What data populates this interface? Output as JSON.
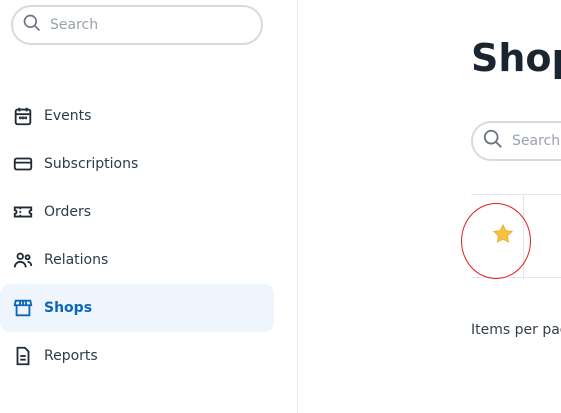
{
  "sidebar": {
    "search_placeholder": "Search",
    "items": [
      {
        "label": "Events",
        "icon": "calendar-icon"
      },
      {
        "label": "Subscriptions",
        "icon": "credit-card-icon"
      },
      {
        "label": "Orders",
        "icon": "ticket-icon"
      },
      {
        "label": "Relations",
        "icon": "people-icon"
      },
      {
        "label": "Shops",
        "icon": "storefront-icon",
        "active": true
      },
      {
        "label": "Reports",
        "icon": "document-icon"
      }
    ]
  },
  "main": {
    "title": "Shop",
    "search_placeholder": "Search",
    "favorite_icon": "star-icon",
    "items_per_page_label": "Items per pag"
  },
  "colors": {
    "accent": "#0b67b8",
    "active_bg": "#eef5fd",
    "star": "#f5c242",
    "annotation": "#e0201a"
  }
}
